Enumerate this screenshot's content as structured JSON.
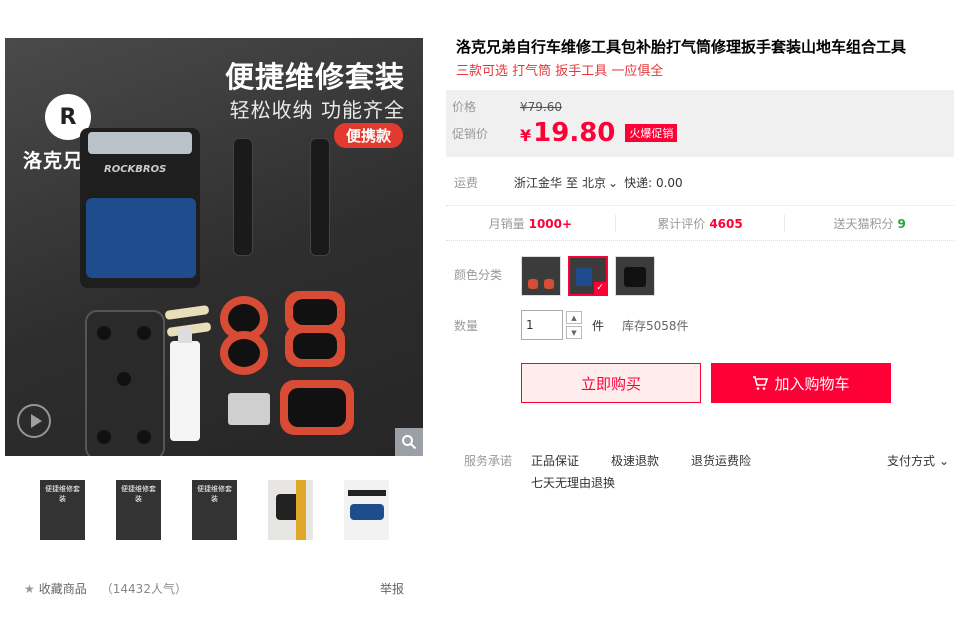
{
  "gallery": {
    "brand_name": "洛克兄弟",
    "logo_letter": "R",
    "headline": "便捷维修套装",
    "subline": "轻松收纳 功能齐全",
    "badge": "便携款",
    "bag_label": "ROCKBROS",
    "thumbs": [
      {
        "title": "便捷维修套装"
      },
      {
        "title": "便捷维修套装"
      },
      {
        "title": "便捷维修套装"
      },
      {
        "title": ""
      },
      {
        "title": ""
      }
    ]
  },
  "footer": {
    "fav_label": "收藏商品",
    "popularity": "（14432人气）",
    "report": "举报"
  },
  "product": {
    "title": "洛克兄弟自行车维修工具包补胎打气筒修理扳手套装山地车组合工具",
    "subtitle": "三款可选 打气筒 扳手工具 一应俱全",
    "price_label": "价格",
    "old_price": "¥79.60",
    "promo_label": "促销价",
    "currency": "¥",
    "promo_price": "19.80",
    "promo_tag": "火爆促销"
  },
  "shipping": {
    "label": "运费",
    "origin": "浙江金华",
    "to": "至",
    "destination": "北京",
    "express": "快递: 0.00"
  },
  "stats": {
    "monthly_sales_label": "月销量",
    "monthly_sales": "1000+",
    "reviews_label": "累计评价",
    "reviews": "4605",
    "points_label": "送天猫积分",
    "points": "9"
  },
  "options": {
    "color_label": "颜色分类",
    "qty_label": "数量",
    "qty_value": "1",
    "unit": "件",
    "stock": "库存5058件"
  },
  "actions": {
    "buy_now": "立即购买",
    "add_cart": "加入购物车"
  },
  "service": {
    "label": "服务承诺",
    "items": [
      "正品保证",
      "极速退款",
      "退货运费险"
    ],
    "item2": "七天无理由退换",
    "payment": "支付方式"
  },
  "colors": {
    "accent": "#ff0036",
    "promo_bg": "#f0f0f0"
  }
}
